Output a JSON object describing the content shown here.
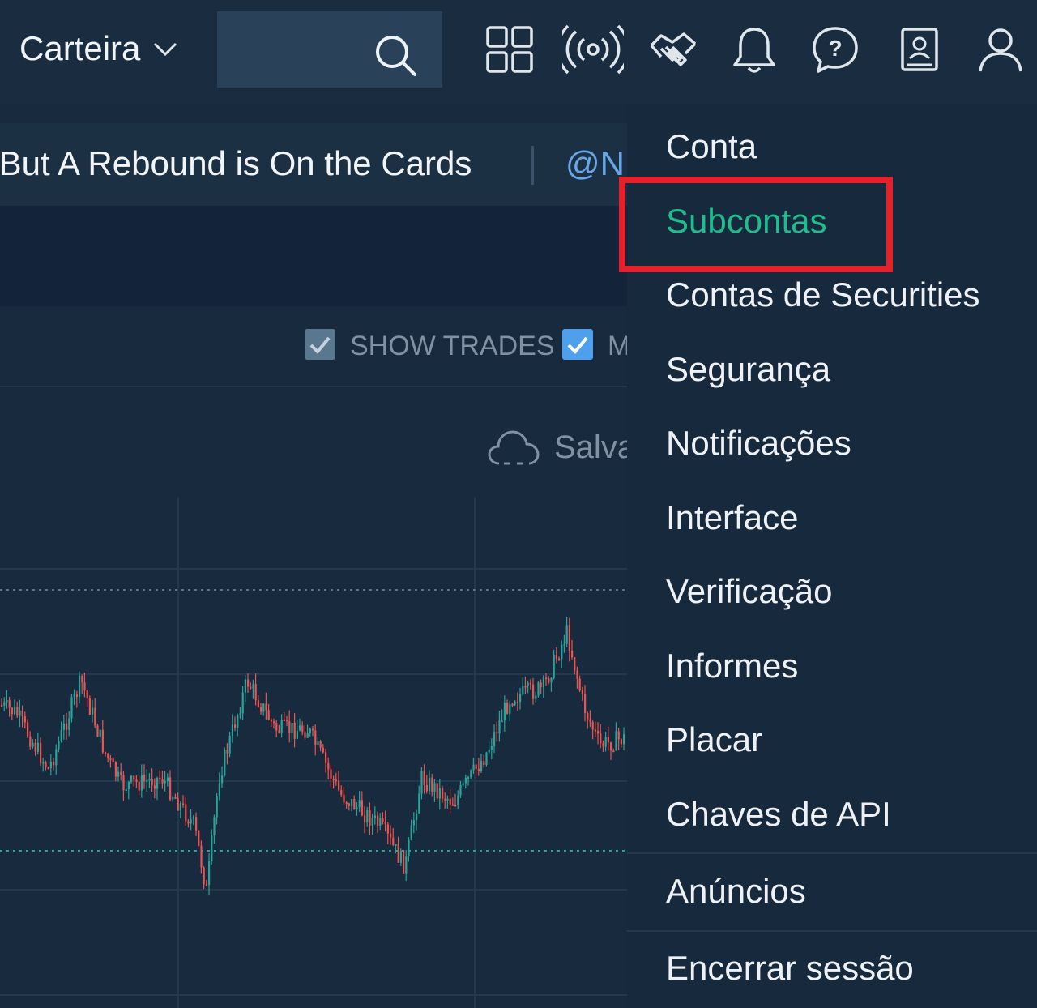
{
  "header": {
    "wallet_label": "Carteira",
    "search_placeholder": "",
    "icons": [
      "grid-icon",
      "broadcast-icon",
      "handshake-icon",
      "bell-icon",
      "help-icon",
      "address-book-icon",
      "user-icon"
    ]
  },
  "ticker": {
    "headline": "y But A Rebound is On the Cards",
    "handle": "@N"
  },
  "chart_options": {
    "show_trades_label": "SHOW TRADES",
    "second_option_label": "M",
    "save_label": "Salva"
  },
  "menu": {
    "items": [
      {
        "label": "Conta"
      },
      {
        "label": "Subcontas",
        "active": true
      },
      {
        "label": "Contas de Securities"
      },
      {
        "label": "Segurança"
      },
      {
        "label": "Notificações"
      },
      {
        "label": "Interface"
      },
      {
        "label": "Verificação"
      },
      {
        "label": "Informes"
      },
      {
        "label": "Placar"
      },
      {
        "label": "Chaves de API"
      }
    ],
    "ads_label": "Anúncios",
    "logout_label": "Encerrar sessão"
  },
  "colors": {
    "background": "#172a3e",
    "accent_green": "#1fbd8e",
    "candle_up": "#26a69a",
    "candle_down": "#ef5350",
    "highlight_red": "#e5212b",
    "link_blue": "#6aa6e6"
  }
}
